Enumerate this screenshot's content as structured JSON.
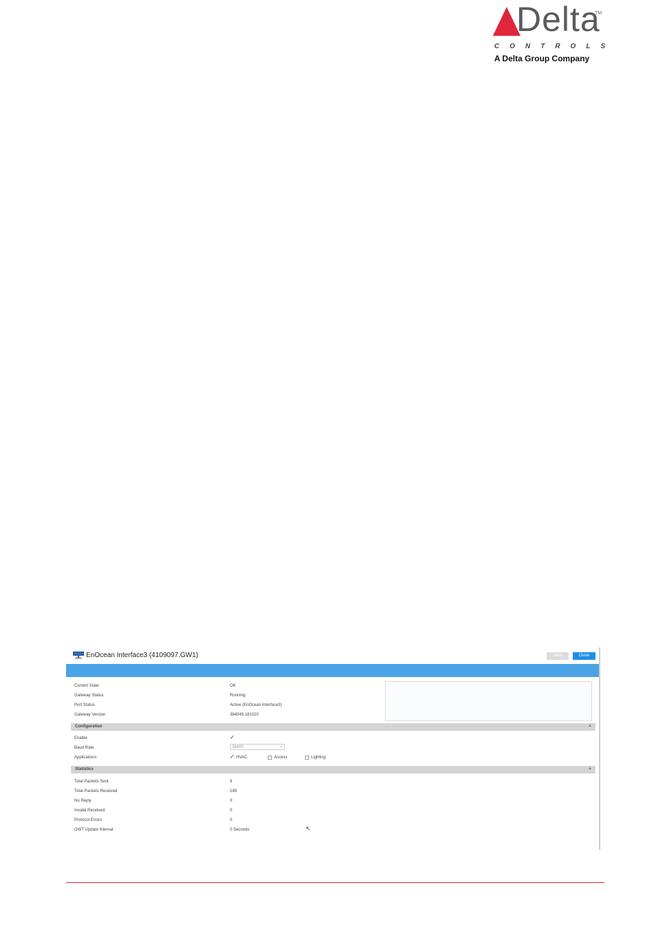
{
  "logo": {
    "wordmark": "Delta",
    "trademark": "TM",
    "controls": "CONTROLS",
    "tagline": "A Delta Group Company",
    "colors": {
      "accent": "#e0263c",
      "wordmark": "#5b5b5b"
    }
  },
  "screenshot": {
    "title": "EnOcean Interface3 (4109097.GW1)",
    "title_icon": "gateway-icon",
    "buttons": {
      "save": "Save",
      "close": "Close"
    },
    "colors": {
      "header_bar": "#4aa3e6",
      "close_button": "#1e90e8",
      "section_bar": "#d4d4d4"
    },
    "status": [
      {
        "label": "Current State",
        "value": "OK"
      },
      {
        "label": "Gateway Status",
        "value": "Running"
      },
      {
        "label": "Port Status",
        "value": "Active (EnOcean Interface3)"
      },
      {
        "label": "Gateway Version",
        "value": "384049.181020"
      }
    ],
    "configuration": {
      "header": "Configuration",
      "enable": {
        "label": "Enable",
        "checked": true,
        "mark": "✓"
      },
      "baud_rate": {
        "label": "Baud Rate",
        "value": "38400"
      },
      "applications": {
        "label": "Applications",
        "options": [
          {
            "label": "HVAC",
            "checked": true,
            "mark": "✓"
          },
          {
            "label": "Access",
            "checked": false
          },
          {
            "label": "Lighting",
            "checked": false
          }
        ]
      }
    },
    "statistics": {
      "header": "Statistics",
      "rows": [
        {
          "label": "Total Packets Sent",
          "value": "6"
        },
        {
          "label": "Total Packets Received",
          "value": "189"
        },
        {
          "label": "No Reply",
          "value": "0"
        },
        {
          "label": "Invalid Received",
          "value": "0"
        },
        {
          "label": "Protocol Errors",
          "value": "0"
        },
        {
          "label": "GWT Update Interval",
          "value": "0 Seconds"
        }
      ]
    }
  }
}
